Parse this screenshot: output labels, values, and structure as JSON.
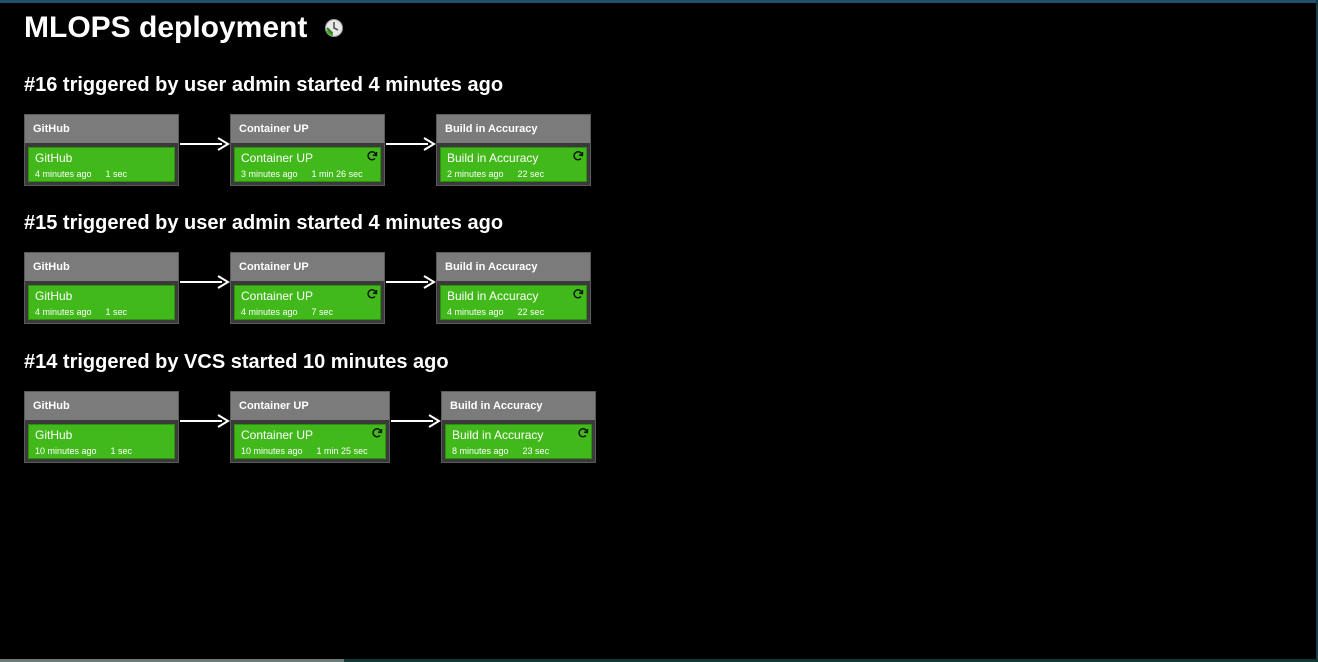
{
  "page": {
    "title": "MLOPS deployment",
    "refresh_icon": "refresh-clock-icon"
  },
  "colors": {
    "background": "#000000",
    "stage_header": "#7b7b7b",
    "stage_success": "#42b91a",
    "stage_frame": "#3a3a3a"
  },
  "runs": [
    {
      "heading": "#16 triggered by user admin started 4 minutes ago",
      "stages": [
        {
          "header": "GitHub",
          "name": "GitHub",
          "time": "4 minutes ago",
          "duration": "1 sec",
          "rebuild": false,
          "status": "success"
        },
        {
          "header": "Container UP",
          "name": "Container UP",
          "time": "3 minutes ago",
          "duration": "1 min 26 sec",
          "rebuild": true,
          "status": "success"
        },
        {
          "header": "Build in Accuracy",
          "name": "Build in Accuracy",
          "time": "2 minutes ago",
          "duration": "22 sec",
          "rebuild": true,
          "status": "success"
        }
      ]
    },
    {
      "heading": "#15 triggered by user admin started 4 minutes ago",
      "stages": [
        {
          "header": "GitHub",
          "name": "GitHub",
          "time": "4 minutes ago",
          "duration": "1 sec",
          "rebuild": false,
          "status": "success"
        },
        {
          "header": "Container UP",
          "name": "Container UP",
          "time": "4 minutes ago",
          "duration": "7 sec",
          "rebuild": true,
          "status": "success"
        },
        {
          "header": "Build in Accuracy",
          "name": "Build in Accuracy",
          "time": "4 minutes ago",
          "duration": "22 sec",
          "rebuild": true,
          "status": "success"
        }
      ]
    },
    {
      "heading": "#14 triggered by VCS started 10 minutes ago",
      "stages": [
        {
          "header": "GitHub",
          "name": "GitHub",
          "time": "10 minutes ago",
          "duration": "1 sec",
          "rebuild": false,
          "status": "success"
        },
        {
          "header": "Container UP",
          "name": "Container UP",
          "time": "10 minutes ago",
          "duration": "1 min 25 sec",
          "rebuild": true,
          "status": "success"
        },
        {
          "header": "Build in Accuracy",
          "name": "Build in Accuracy",
          "time": "8 minutes ago",
          "duration": "23 sec",
          "rebuild": true,
          "status": "success"
        }
      ]
    }
  ]
}
